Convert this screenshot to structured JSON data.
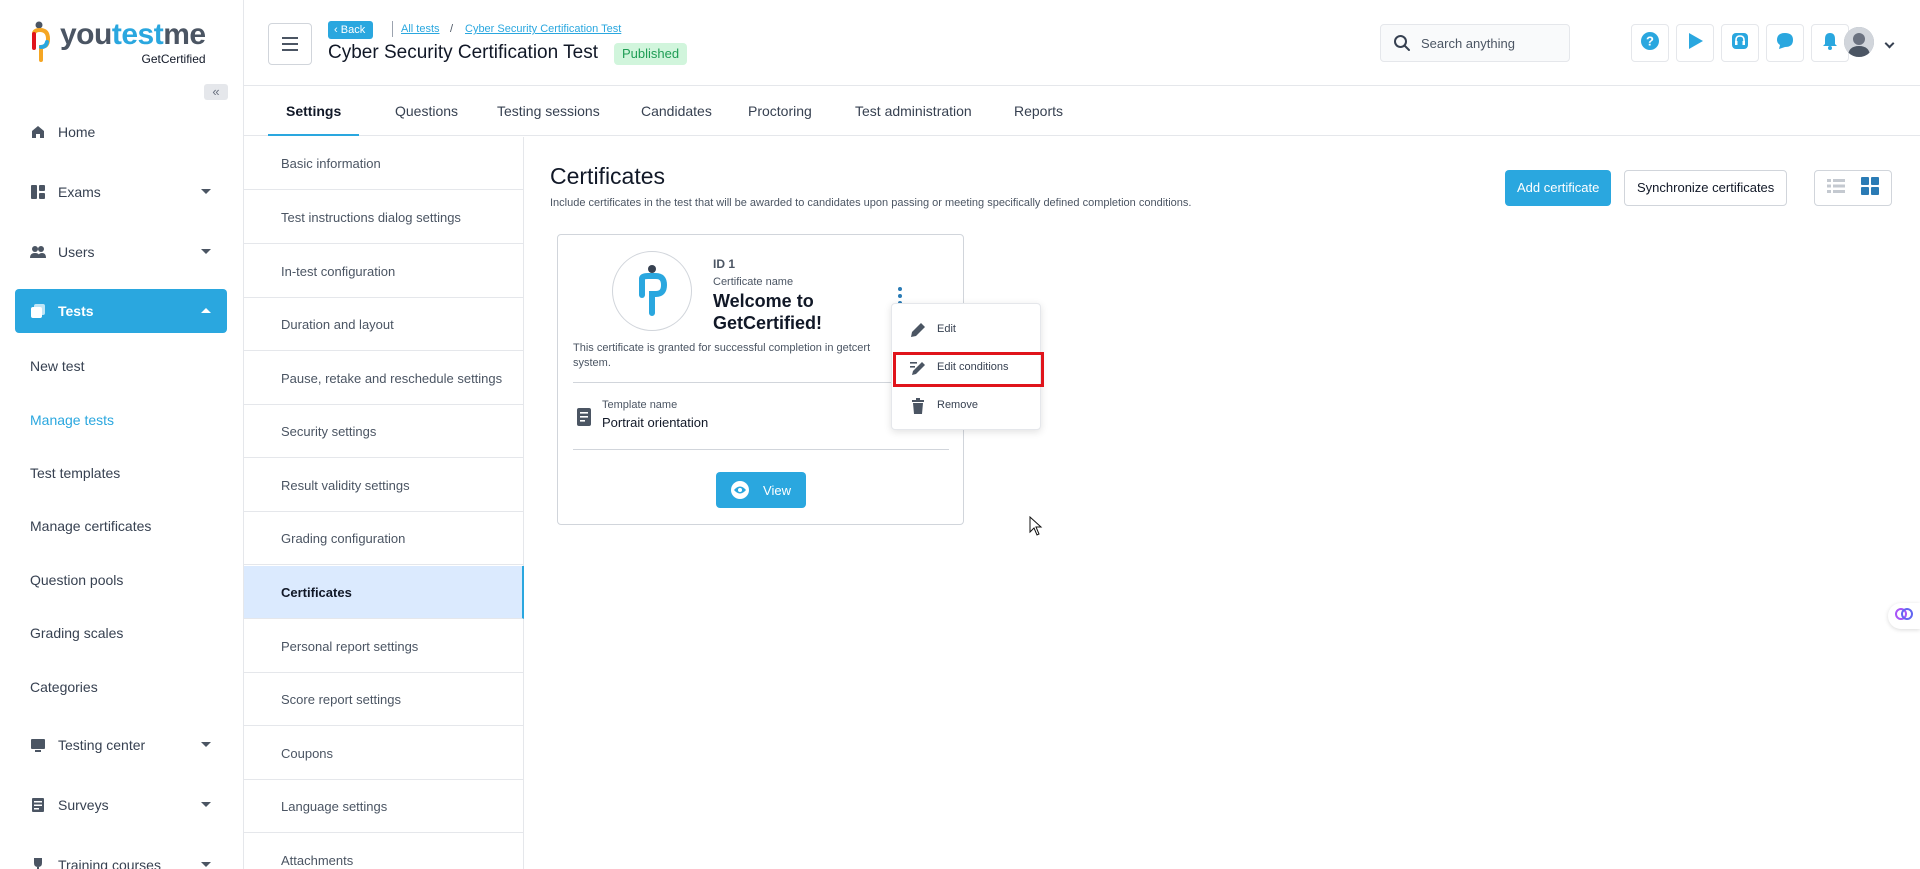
{
  "brand": {
    "logo_text_1": "you",
    "logo_text_2": "test",
    "logo_text_3": "me",
    "logo_sub": "GetCertified"
  },
  "sidebar": {
    "items": [
      {
        "label": "Home",
        "icon": "home-icon"
      },
      {
        "label": "Exams",
        "icon": "exams-icon"
      },
      {
        "label": "Users",
        "icon": "users-icon"
      },
      {
        "label": "Tests",
        "icon": "tests-icon"
      },
      {
        "label": "Testing center",
        "icon": "testing-center-icon"
      },
      {
        "label": "Surveys",
        "icon": "surveys-icon"
      },
      {
        "label": "Training courses",
        "icon": "trophy-icon"
      }
    ],
    "tests_sub": [
      "New test",
      "Manage tests",
      "Test templates",
      "Manage certificates",
      "Question pools",
      "Grading scales",
      "Categories"
    ]
  },
  "header": {
    "back_label": "Back",
    "crumb_all_tests": "All tests",
    "crumb_sep": "/",
    "crumb_current": "Cyber Security Certification Test",
    "title": "Cyber Security Certification Test",
    "status": "Published",
    "search_placeholder": "Search anything"
  },
  "tabs": [
    "Settings",
    "Questions",
    "Testing sessions",
    "Candidates",
    "Proctoring",
    "Test administration",
    "Reports"
  ],
  "settings_menu": [
    "Basic information",
    "Test instructions dialog settings",
    "In-test configuration",
    "Duration and layout",
    "Pause, retake and reschedule settings",
    "Security settings",
    "Result validity settings",
    "Grading configuration",
    "Certificates",
    "Personal report settings",
    "Score report settings",
    "Coupons",
    "Language settings",
    "Attachments"
  ],
  "main": {
    "title": "Certificates",
    "description": "Include certificates in the test that will be awarded to candidates upon passing or meeting specifically defined completion conditions.",
    "add_button": "Add certificate",
    "sync_button": "Synchronize certificates"
  },
  "certificate": {
    "id_label": "ID 1",
    "name_label": "Certificate name",
    "name": "Welcome to GetCertified!",
    "description_line1": "This certificate is granted for successful completion in getcert",
    "description_line2": "system.",
    "template_label": "Template name",
    "template_name": "Portrait orientation",
    "view_button": "View"
  },
  "dropdown": {
    "items": [
      {
        "label": "Edit",
        "icon": "pencil-icon"
      },
      {
        "label": "Edit conditions",
        "icon": "edit-conditions-icon"
      },
      {
        "label": "Remove",
        "icon": "trash-icon"
      }
    ]
  },
  "colors": {
    "accent": "#2aa7df",
    "highlight": "#e0141b",
    "published_bg": "#d1f5dc",
    "published_text": "#1f9d55"
  }
}
